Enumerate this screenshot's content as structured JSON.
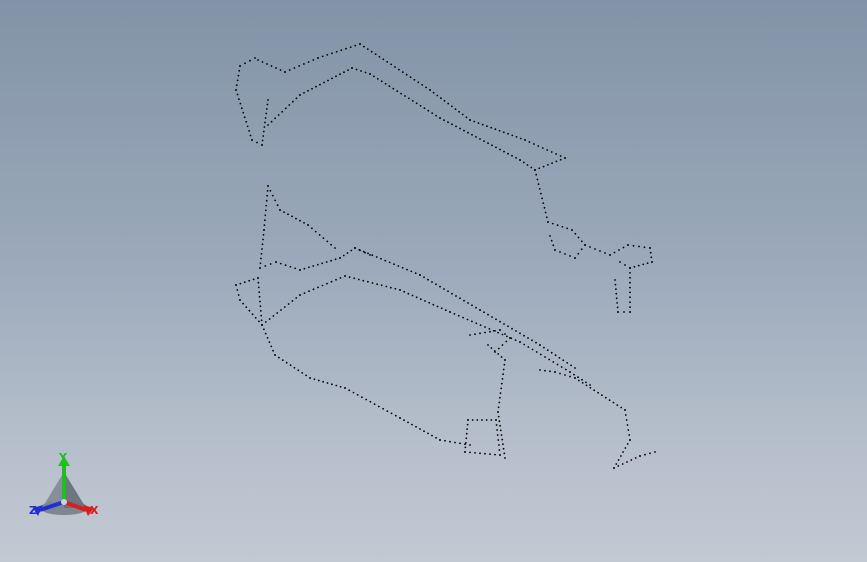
{
  "viewport": {
    "background_top": "#8393a7",
    "background_bottom": "#c2c9d3",
    "model_kind": "point-cloud wireframe",
    "point_color": "#000000"
  },
  "triad": {
    "x_label": "X",
    "y_label": "Y",
    "z_label": "Z",
    "x_color": "#d62020",
    "y_color": "#1fbf1f",
    "z_color": "#2030d0"
  }
}
